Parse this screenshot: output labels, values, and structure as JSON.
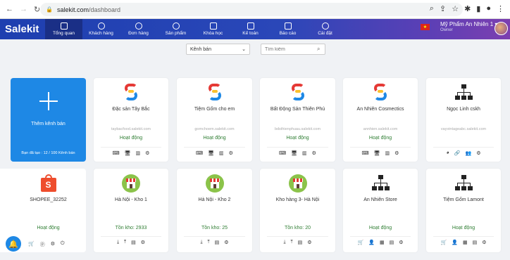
{
  "browser": {
    "back": "←",
    "forward": "→",
    "reload": "↻",
    "url_host": "salekit.com",
    "url_path": "/dashboard"
  },
  "app": {
    "logo": "Salekit",
    "nav": [
      {
        "label": "Tổng quan",
        "icon": "home-icon",
        "active": true
      },
      {
        "label": "Khách hàng",
        "icon": "users-icon"
      },
      {
        "label": "Đơn hàng",
        "icon": "dollar-icon"
      },
      {
        "label": "Sản phẩm",
        "icon": "product-icon"
      },
      {
        "label": "Khóa học",
        "icon": "book-icon"
      },
      {
        "label": "Kế toán",
        "icon": "card-icon"
      },
      {
        "label": "Báo cáo",
        "icon": "chart-icon"
      },
      {
        "label": "Cài đặt",
        "icon": "gear-icon"
      }
    ],
    "user_name": "Mỹ Phẩm An Nhiên 1",
    "user_role": "Owner"
  },
  "filters": {
    "channel_select": "Kênh bán",
    "search_placeholder": "Tìm kiếm"
  },
  "add_card": {
    "label": "Thêm kênh bán",
    "quota": "Bạn đã tạo : 12 / 100 Kênh bán"
  },
  "channels_row1": [
    {
      "name": "Đặc sản Tây Bắc",
      "domain": "taybacfood.salekit.com",
      "status": "Hoạt động",
      "logo": "salekit-s-logo"
    },
    {
      "name": "Tiệm Gốm cho em",
      "domain": "gomchoem.salekit.com",
      "status": "Hoạt động",
      "logo": "salekit-s-logo"
    },
    {
      "name": "Bất Động Sản Thiên Phú",
      "domain": "bdsthienphuau.salekit.com",
      "status": "Hoạt động",
      "logo": "salekit-s-logo"
    },
    {
      "name": "An Nhiên Cosmectics",
      "domain": "annhien.salekit.com",
      "status": "Hoạt động",
      "logo": "salekit-s-logo"
    },
    {
      "name": "Ngọc Linh cskh",
      "domain": "vayvintageabc.salekit.com",
      "status": "",
      "logo": "network-icon"
    }
  ],
  "channels_row2": [
    {
      "name": "SHOPEE_32252",
      "status": "Hoạt động",
      "logo": "shopee-icon"
    },
    {
      "name": "Hà Nội - Kho 1",
      "status": "Tồn kho: 2933",
      "logo": "store-icon"
    },
    {
      "name": "Hà Nội - Kho 2",
      "status": "Tồn kho: 25",
      "logo": "store-icon"
    },
    {
      "name": "Kho hàng 3- Hà Nội",
      "status": "Tồn kho: 20",
      "logo": "store-icon"
    },
    {
      "name": "An Nhiên Store",
      "status": "Hoạt động",
      "logo": "network-icon"
    },
    {
      "name": "Tiệm Gốm Lamont",
      "status": "Hoạt động",
      "logo": "network-icon"
    }
  ],
  "colors": {
    "accent": "#1e88e5",
    "header_start": "#1e3fb0",
    "header_end": "#7c3fb0",
    "status_green": "#2e7d32"
  }
}
